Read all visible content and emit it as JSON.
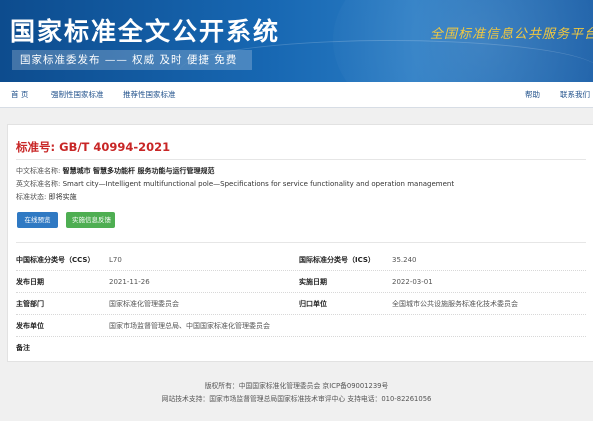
{
  "banner": {
    "title": "国家标准全文公开系统",
    "subtitle": "国家标准委发布 —— 权威 及时 便捷 免费",
    "slogan": "全国标准信息公共服务平台"
  },
  "nav": {
    "items": [
      {
        "label": "首 页"
      },
      {
        "label": "强制性国家标准"
      },
      {
        "label": "推荐性国家标准"
      }
    ],
    "right_items": [
      {
        "label": "帮助"
      },
      {
        "label": "联系我们"
      }
    ]
  },
  "standard": {
    "number_label": "标准号:",
    "number": "GB/T 40994-2021",
    "cn_name_label": "中文标准名称:",
    "cn_name": "智慧城市 智慧多功能杆 服务功能与运行管理规范",
    "en_name_label": "英文标准名称:",
    "en_name": "Smart city—Intelligent multifunctional pole—Specifications for service functionality and operation management",
    "status_label": "标准状态:",
    "status": "即将实施"
  },
  "buttons": {
    "online_preview": "在线预览",
    "feedback": "实施信息反馈"
  },
  "details": {
    "ccs_label": "中国标准分类号（CCS）",
    "ccs": "L70",
    "ics_label": "国际标准分类号（ICS）",
    "ics": "35.240",
    "publish_date_label": "发布日期",
    "publish_date": "2021-11-26",
    "implement_date_label": "实施日期",
    "implement_date": "2022-03-01",
    "dept_label": "主管部门",
    "dept": "国家标准化管理委员会",
    "owner_label": "归口单位",
    "owner": "全国城市公共设施服务标准化技术委员会",
    "issuer_label": "发布单位",
    "issuer": "国家市场监督管理总局、中国国家标准化管理委员会",
    "remark_label": "备注",
    "remark": ""
  },
  "footer": {
    "line1": "版权所有：中国国家标准化管理委员会 京ICP备09001239号",
    "line2": "网站技术支持：国家市场监督管理总局国家标准技术审评中心 支持电话：010-82261056"
  },
  "colors": {
    "banner_blue": "#1767b2",
    "slogan_gold": "#f1c840",
    "std_red": "#c82626",
    "button_blue": "#2f79c3",
    "button_green": "#4eae52"
  }
}
